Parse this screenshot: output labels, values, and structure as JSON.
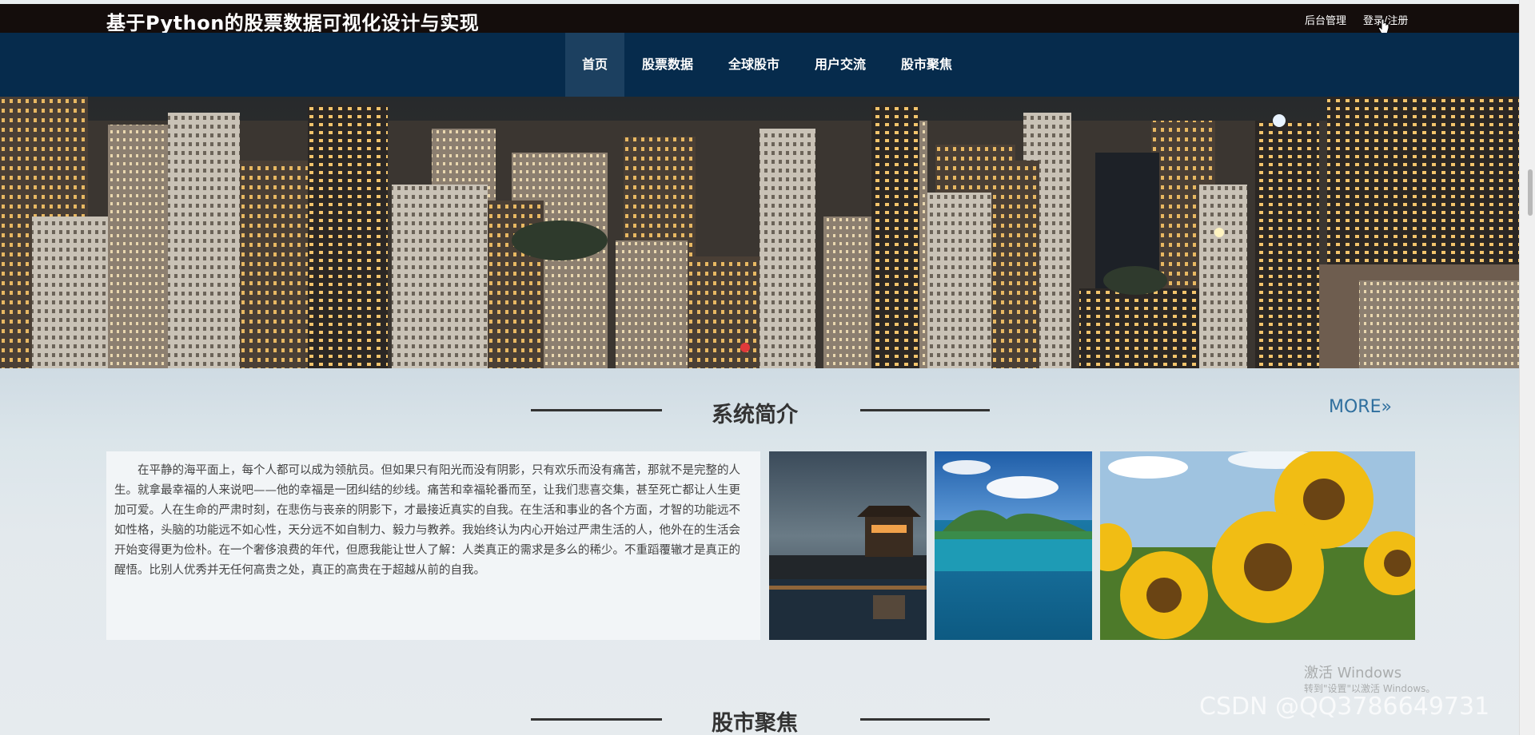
{
  "header": {
    "site_title": "基于Python的股票数据可视化设计与实现",
    "links": {
      "admin": "后台管理",
      "login": "登录/注册"
    }
  },
  "nav": {
    "items": [
      {
        "label": "首页",
        "active": true
      },
      {
        "label": "股票数据",
        "active": false
      },
      {
        "label": "全球股市",
        "active": false
      },
      {
        "label": "用户交流",
        "active": false
      },
      {
        "label": "股市聚焦",
        "active": false
      }
    ]
  },
  "banner": {
    "slides_indicator_active": 1
  },
  "intro_section": {
    "title": "系统简介",
    "more_label": "MORE»",
    "text": "在平静的海平面上，每个人都可以成为领航员。但如果只有阳光而没有阴影，只有欢乐而没有痛苦，那就不是完整的人生。就拿最幸福的人来说吧——他的幸福是一团纠结的纱线。痛苦和幸福轮番而至，让我们悲喜交集，甚至死亡都让人生更加可爱。人在生命的严肃时刻，在悲伤与丧亲的阴影下，才最接近真实的自我。在生活和事业的各个方面，才智的功能远不如性格，头脑的功能远不如心性，天分远不如自制力、毅力与教养。我始终认为内心开始过严肃生活的人，他外在的生活会开始变得更为俭朴。在一个奢侈浪费的年代，但愿我能让世人了解：人类真正的需求是多么的稀少。不重蹈覆辙才是真正的醒悟。比别人优秀并无任何高贵之处，真正的高贵在于超越从前的自我。",
    "photos": [
      "palace-night-photo",
      "island-lagoon-photo",
      "sunflower-photo"
    ]
  },
  "focus_section": {
    "title": "股市聚焦"
  },
  "watermarks": {
    "activate_windows": "激活 Windows",
    "activate_hint": "转到\"设置\"以激活 Windows。",
    "csdn": "CSDN @QQ3786649731"
  },
  "colors": {
    "topbar": "#140d0c",
    "navbar": "#062b4c",
    "nav_active": "#1c4060",
    "more_link": "#2f6f9e"
  }
}
